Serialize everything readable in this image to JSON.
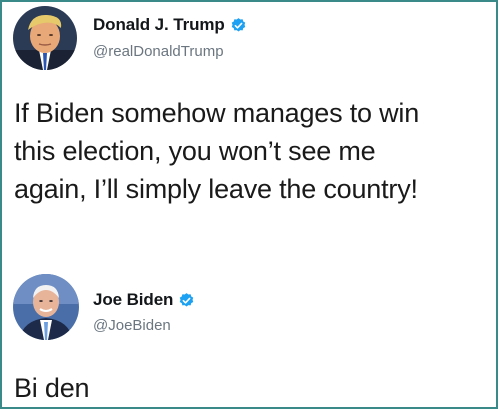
{
  "tweets": [
    {
      "display_name": "Donald J. Trump",
      "handle": "@realDonaldTrump",
      "text": "If Biden somehow manages to win\nthis election, you won’t see me\nagain, I’ll simply leave the country!",
      "verified": true
    },
    {
      "display_name": "Joe Biden",
      "handle": "@JoeBiden",
      "text": "Bi den",
      "verified": true
    }
  ],
  "colors": {
    "verified_badge": "#1da1f2",
    "frame_border": "#3a8a8a",
    "handle_text": "#6b7680"
  },
  "icons": {
    "verified": "verified-badge-icon",
    "avatar_trump": "profile-photo",
    "avatar_biden": "profile-photo"
  }
}
